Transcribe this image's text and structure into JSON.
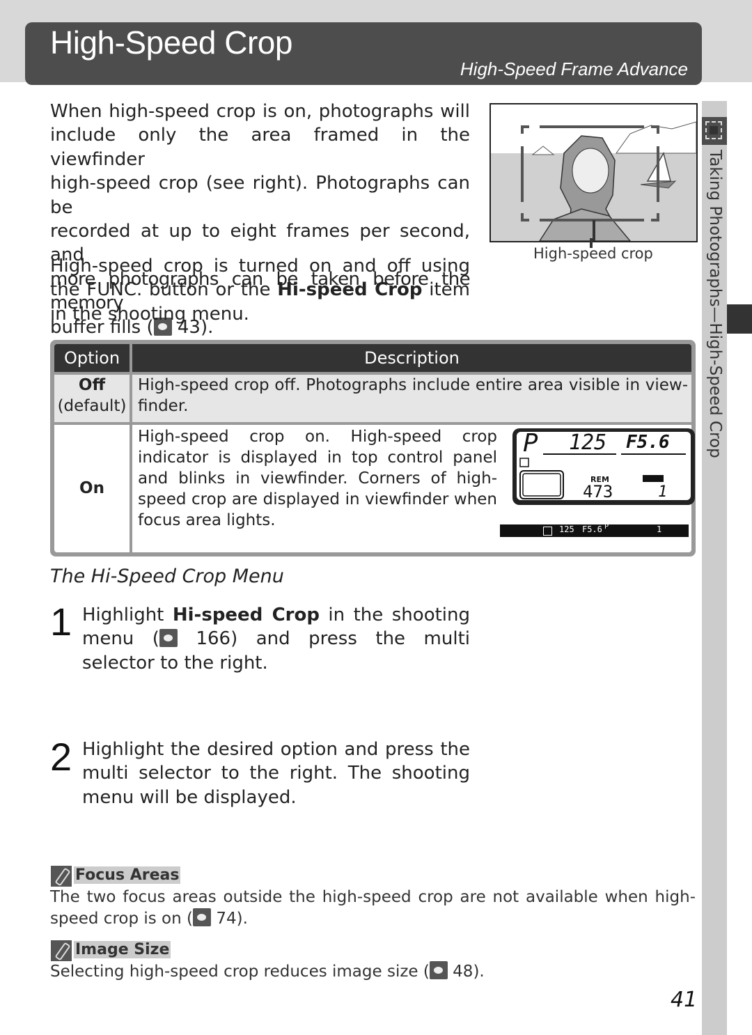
{
  "header": {
    "title": "High-Speed Crop",
    "subtitle": "High-Speed Frame Advance"
  },
  "sidebar": {
    "section_label": "Taking Photographs—High-Speed Crop",
    "icon": "high-speed-crop-icon"
  },
  "intro": {
    "para1_lines": [
      "When high-speed crop is on, photographs will",
      "include only the area framed in the viewfinder",
      "high-speed crop (see right).  Photographs can be",
      "recorded at up to eight frames per second, and",
      "more photographs can be taken before the memory"
    ],
    "para1_last_pre": "buffer fills (",
    "para1_ref": "43",
    "para1_last_post": ").",
    "para2_pre": "High-speed crop is turned on and off using the FUNC. button or the ",
    "para2_bold": "Hi-speed Crop",
    "para2_post": " item in the shooting menu."
  },
  "figure": {
    "caption": "High-speed crop"
  },
  "table": {
    "headers": [
      "Option",
      "Description"
    ],
    "rows": [
      {
        "option": "Off",
        "option_note": "(default)",
        "description": "High-speed crop off.  Photographs include entire area visible in view-finder."
      },
      {
        "option": "On",
        "description": "High-speed crop on.  High-speed crop indicator is displayed in top control panel and blinks in viewfinder.  Corners of high-speed crop are displayed in viewfinder when focus area lights."
      }
    ],
    "lcd": {
      "mode": "P",
      "shutter": "125",
      "aperture": "F5.6",
      "rem_label": "REM",
      "remaining": "473",
      "buffer": "1"
    },
    "viewfinder_strip": {
      "shutter": "125",
      "aperture": "F5.6",
      "mode": "P",
      "buffer": "1"
    }
  },
  "menu_section": {
    "title": "The Hi-Speed Crop Menu",
    "steps": [
      {
        "number": "1",
        "pre": "Highlight ",
        "bold": "Hi-speed Crop",
        "mid": " in the shooting menu (",
        "ref": "166",
        "post": ") and press the multi selector to the right."
      },
      {
        "number": "2",
        "text": "Highlight the desired option and press the multi selector to the right.  The shooting menu will be displayed."
      }
    ]
  },
  "notes": [
    {
      "title": "Focus Areas",
      "pre": "The two focus areas outside the high-speed crop are not available when high-speed crop is on (",
      "ref": "74",
      "post": ")."
    },
    {
      "title": "Image Size",
      "pre": "Selecting high-speed crop reduces image size (",
      "ref": "48",
      "post": ")."
    }
  ],
  "page_number": "41"
}
